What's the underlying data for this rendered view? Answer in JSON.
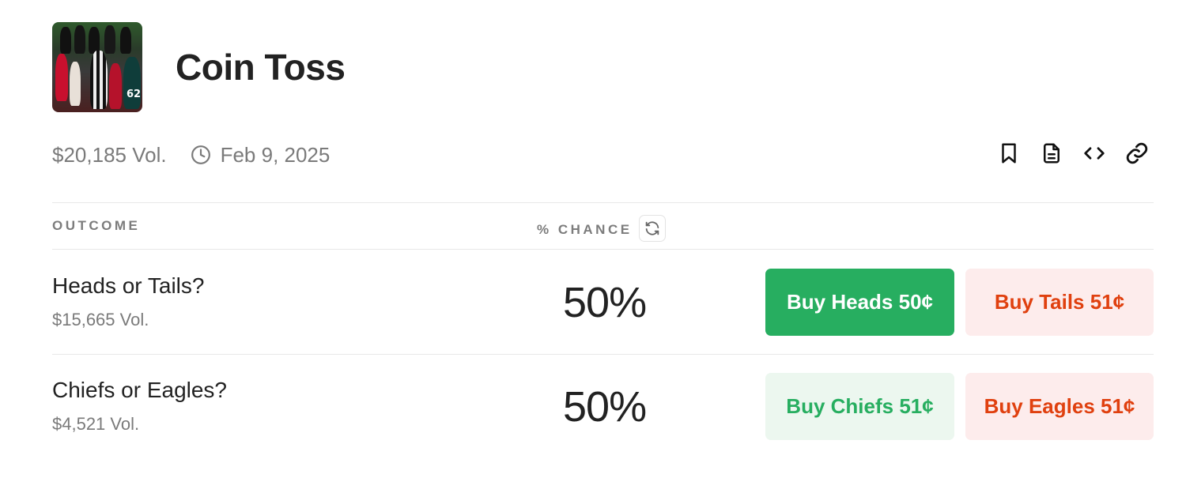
{
  "market": {
    "title": "Coin Toss",
    "volume": "$20,185 Vol.",
    "date": "Feb 9, 2025"
  },
  "actions": [
    "bookmark-icon",
    "document-icon",
    "embed-code-icon",
    "link-icon"
  ],
  "table": {
    "col_outcome": "OUTCOME",
    "col_chance": "% CHANCE"
  },
  "outcomes": [
    {
      "name": "Heads or Tails?",
      "volume": "$15,665 Vol.",
      "chance": "50%",
      "yes_label": "Buy Heads 50¢",
      "no_label": "Buy Tails 51¢"
    },
    {
      "name": "Chiefs or Eagles?",
      "volume": "$4,521 Vol.",
      "chance": "50%",
      "yes_label": "Buy Chiefs 51¢",
      "no_label": "Buy Eagles 51¢"
    }
  ],
  "colors": {
    "green": "#27ae60",
    "green_light": "#ecf7ef",
    "red": "#e0400f",
    "red_light": "#fdecec"
  }
}
